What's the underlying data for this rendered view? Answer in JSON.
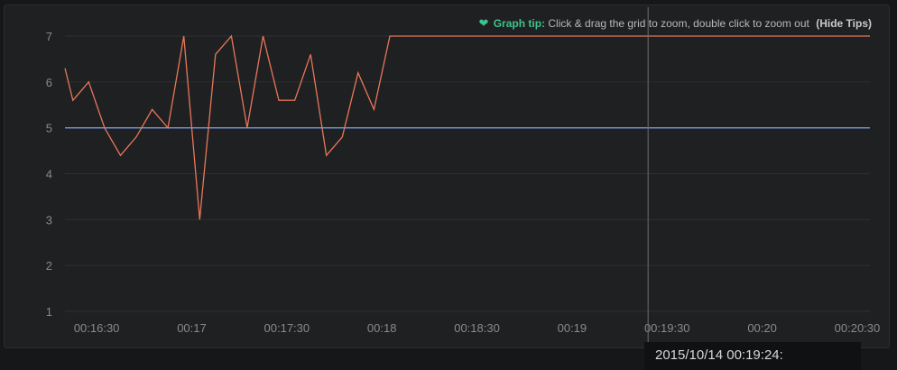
{
  "tip": {
    "icon": "heart-icon",
    "label": "Graph tip:",
    "text": "Click & drag the grid to zoom, double click to zoom out",
    "hide": "(Hide Tips)"
  },
  "tooltip": {
    "text": "2015/10/14 00:19:24:"
  },
  "colors": {
    "series_orange": "#e8765a",
    "series_blue": "#7c9ae3",
    "grid": "#2f3031",
    "crosshair": "#6d6e70",
    "accent": "#3ec38f"
  },
  "chart_data": {
    "type": "line",
    "ylim": [
      1,
      7
    ],
    "yticks": [
      1,
      2,
      3,
      4,
      5,
      6,
      7
    ],
    "xticks": [
      {
        "t": 990,
        "label": "00:16:30"
      },
      {
        "t": 1020,
        "label": "00:17"
      },
      {
        "t": 1050,
        "label": "00:17:30"
      },
      {
        "t": 1080,
        "label": "00:18"
      },
      {
        "t": 1110,
        "label": "00:18:30"
      },
      {
        "t": 1140,
        "label": "00:19"
      },
      {
        "t": 1170,
        "label": "00:19:30"
      },
      {
        "t": 1200,
        "label": "00:20"
      },
      {
        "t": 1230,
        "label": "00:20:30"
      }
    ],
    "xlim": [
      980,
      1234
    ],
    "crosshair_t": 1164,
    "grid": true,
    "series": [
      {
        "points": [
          [
            980,
            6.3
          ],
          [
            982.5,
            5.6
          ],
          [
            987.5,
            6.0
          ],
          [
            992.5,
            5.0
          ],
          [
            997.5,
            4.4
          ],
          [
            1002.5,
            4.8
          ],
          [
            1007.5,
            5.4
          ],
          [
            1012.5,
            5.0
          ],
          [
            1017.5,
            7.0
          ],
          [
            1022.5,
            3.0
          ],
          [
            1027.5,
            6.6
          ],
          [
            1032.5,
            7.0
          ],
          [
            1037.5,
            5.0
          ],
          [
            1042.5,
            7.0
          ],
          [
            1047.5,
            5.6
          ],
          [
            1052.5,
            5.6
          ],
          [
            1057.5,
            6.6
          ],
          [
            1062.5,
            4.4
          ],
          [
            1067.5,
            4.8
          ],
          [
            1072.5,
            6.2
          ],
          [
            1077.5,
            5.4
          ],
          [
            1082.5,
            7.0
          ],
          [
            1234,
            7.0
          ]
        ]
      },
      {
        "points": [
          [
            980,
            5.0
          ],
          [
            1234,
            5.0
          ]
        ]
      }
    ]
  }
}
